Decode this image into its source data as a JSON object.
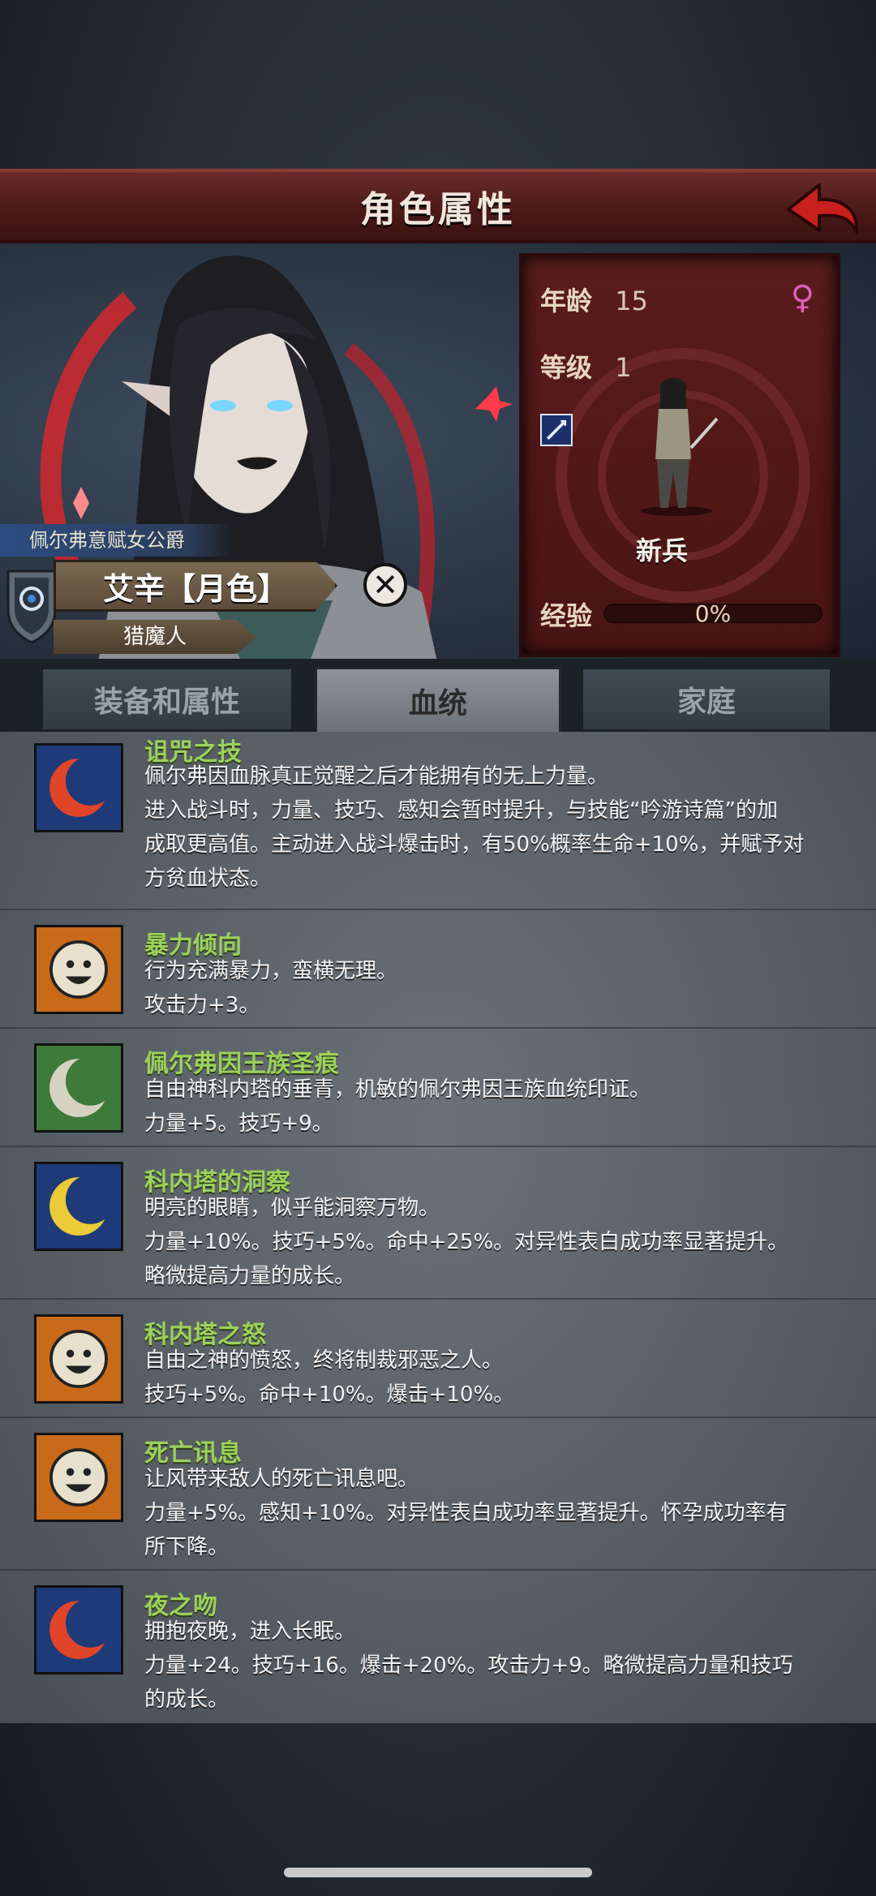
{
  "header": {
    "title": "角色属性"
  },
  "character": {
    "noble_title": "佩尔弗意赋女公爵",
    "name": "艾辛【月色】",
    "race": "猎魔人",
    "age_label": "年龄",
    "age": "15",
    "level_label": "等级",
    "level": "1",
    "class": "新兵",
    "exp_label": "经验",
    "exp_percent": "0%"
  },
  "tabs": [
    {
      "label": "装备和属性",
      "active": false
    },
    {
      "label": "血统",
      "active": true
    },
    {
      "label": "家庭",
      "active": false
    }
  ],
  "traits": [
    {
      "name": "诅咒之技",
      "icon": "red-crescent-icon",
      "lines": [
        "佩尔弗因血脉真正觉醒之后才能拥有的无上力量。",
        "进入战斗时，力量、技巧、感知会暂时提升，与技能“吟游诗篇”的加",
        "成取更高值。主动进入战斗爆击时，有50%概率生命+10%，并赋予对",
        "方贫血状态。"
      ]
    },
    {
      "name": "暴力倾向",
      "icon": "orange-smile-icon",
      "lines": [
        "行为充满暴力，蛮横无理。",
        "攻击力+3。"
      ]
    },
    {
      "name": "佩尔弗因王族圣痕",
      "icon": "white-crescent-icon",
      "lines": [
        "自由神科内塔的垂青，机敏的佩尔弗因王族血统印证。",
        "力量+5。技巧+9。"
      ]
    },
    {
      "name": "科内塔的洞察",
      "icon": "gold-crescent-icon",
      "lines": [
        "明亮的眼睛，似乎能洞察万物。",
        "力量+10%。技巧+5%。命中+25%。对异性表白成功率显著提升。",
        "略微提高力量的成长。"
      ]
    },
    {
      "name": "科内塔之怒",
      "icon": "orange-smile-icon",
      "lines": [
        "自由之神的愤怒，终将制裁邪恶之人。",
        "技巧+5%。命中+10%。爆击+10%。"
      ]
    },
    {
      "name": "死亡讯息",
      "icon": "orange-smile-icon",
      "lines": [
        "让风带来敌人的死亡讯息吧。",
        "力量+5%。感知+10%。对异性表白成功率显著提升。怀孕成功率有",
        "所下降。"
      ]
    },
    {
      "name": "夜之吻",
      "icon": "red-crescent-icon",
      "lines": [
        "拥抱夜晚，进入长眠。",
        "力量+24。技巧+16。爆击+20%。攻击力+9。略微提高力量和技巧",
        "的成长。"
      ]
    }
  ],
  "colors": {
    "trait_title": "#9cd15a",
    "header_bg": "#4a1818",
    "panel_bg": "#5a1c1c"
  }
}
